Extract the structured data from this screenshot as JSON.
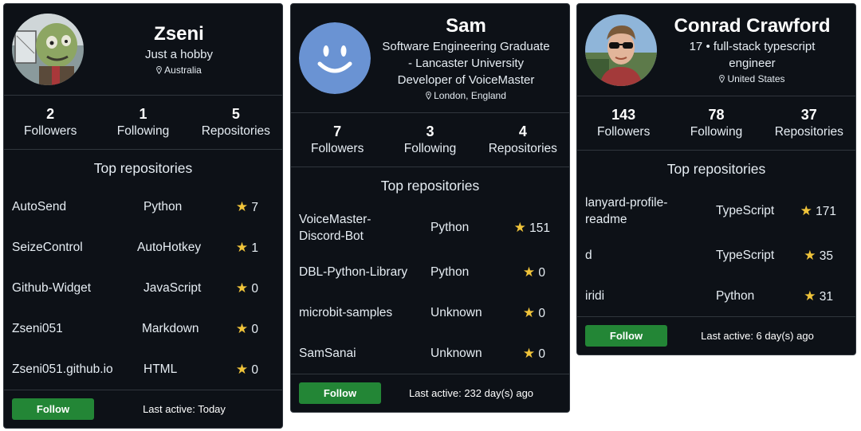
{
  "cards": [
    {
      "name": "Zseni",
      "bio": [
        "Just a hobby"
      ],
      "location": "Australia",
      "stats": [
        {
          "value": "2",
          "label": "Followers"
        },
        {
          "value": "1",
          "label": "Following"
        },
        {
          "value": "5",
          "label": "Repositories"
        }
      ],
      "repos_title": "Top repositories",
      "repos": [
        {
          "name": "AutoSend",
          "lang": "Python",
          "stars": "7"
        },
        {
          "name": "SeizeControl",
          "lang": "AutoHotkey",
          "stars": "1"
        },
        {
          "name": "Github-Widget",
          "lang": "JavaScript",
          "stars": "0"
        },
        {
          "name": "Zseni051",
          "lang": "Markdown",
          "stars": "0"
        },
        {
          "name": "Zseni051.github.io",
          "lang": "HTML",
          "stars": "0"
        }
      ],
      "follow_label": "Follow",
      "last_active": "Last active: Today"
    },
    {
      "name": "Sam",
      "bio": [
        "Software Engineering Graduate",
        "- Lancaster University",
        "Developer of VoiceMaster"
      ],
      "location": "London, England",
      "stats": [
        {
          "value": "7",
          "label": "Followers"
        },
        {
          "value": "3",
          "label": "Following"
        },
        {
          "value": "4",
          "label": "Repositories"
        }
      ],
      "repos_title": "Top repositories",
      "repos": [
        {
          "name": "VoiceMaster-Discord-Bot",
          "lang": "Python",
          "stars": "151"
        },
        {
          "name": "DBL-Python-Library",
          "lang": "Python",
          "stars": "0"
        },
        {
          "name": "microbit-samples",
          "lang": "Unknown",
          "stars": "0"
        },
        {
          "name": "SamSanai",
          "lang": "Unknown",
          "stars": "0"
        }
      ],
      "follow_label": "Follow",
      "last_active": "Last active: 232 day(s) ago"
    },
    {
      "name": "Conrad Crawford",
      "bio": [
        "17 • full-stack typescript",
        "engineer"
      ],
      "location": "United States",
      "stats": [
        {
          "value": "143",
          "label": "Followers"
        },
        {
          "value": "78",
          "label": "Following"
        },
        {
          "value": "37",
          "label": "Repositories"
        }
      ],
      "repos_title": "Top repositories",
      "repos": [
        {
          "name": "lanyard-profile-readme",
          "lang": "TypeScript",
          "stars": "171"
        },
        {
          "name": "d",
          "lang": "TypeScript",
          "stars": "35"
        },
        {
          "name": "iridi",
          "lang": "Python",
          "stars": "31"
        }
      ],
      "follow_label": "Follow",
      "last_active": "Last active: 6 day(s) ago"
    }
  ],
  "icons": {
    "location": "map-pin-icon",
    "star": "star-icon"
  },
  "colors": {
    "background": "#0d1117",
    "border": "#30363d",
    "follow": "#238636",
    "star": "#f0c43a",
    "sam_avatar": "#6a93d3"
  }
}
